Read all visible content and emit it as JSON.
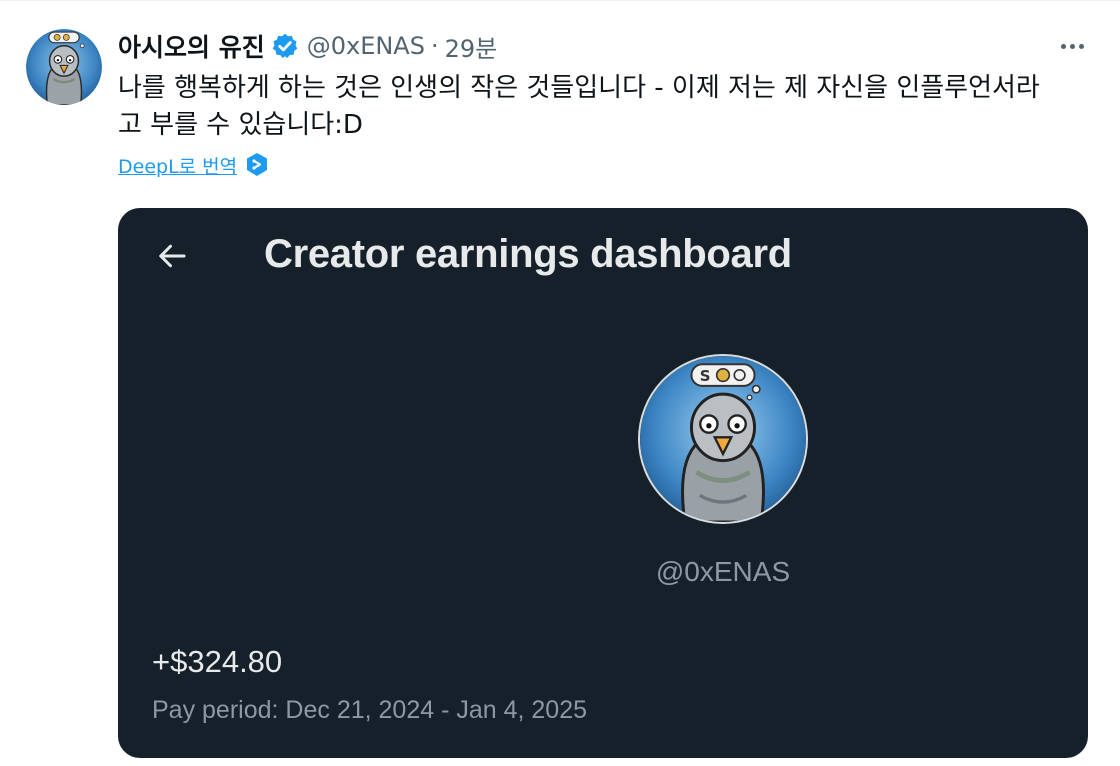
{
  "tweet": {
    "display_name": "아시오의 유진",
    "handle": "@0xENAS",
    "separator": "·",
    "time": "29분",
    "text": "나를 행복하게 하는 것은 인생의 작은 것들입니다 - 이제 저는 제 자신을 인플루언서라\n고 부를 수 있습니다:D",
    "translate_label": "DeepL로 번역"
  },
  "card": {
    "title": "Creator earnings dashboard",
    "handle": "@0xENAS",
    "earnings": "+$324.80",
    "pay_period": "Pay period: Dec 21, 2024 - Jan 4, 2025",
    "avatar_badge_text": "S"
  },
  "colors": {
    "card_background": "#15202b",
    "verified_blue": "#1d9bf0",
    "muted_text": "#536471"
  },
  "icons": {
    "verified": "verified-badge-icon",
    "more": "more-icon",
    "translate": "deepl-icon",
    "back": "back-arrow-icon"
  }
}
